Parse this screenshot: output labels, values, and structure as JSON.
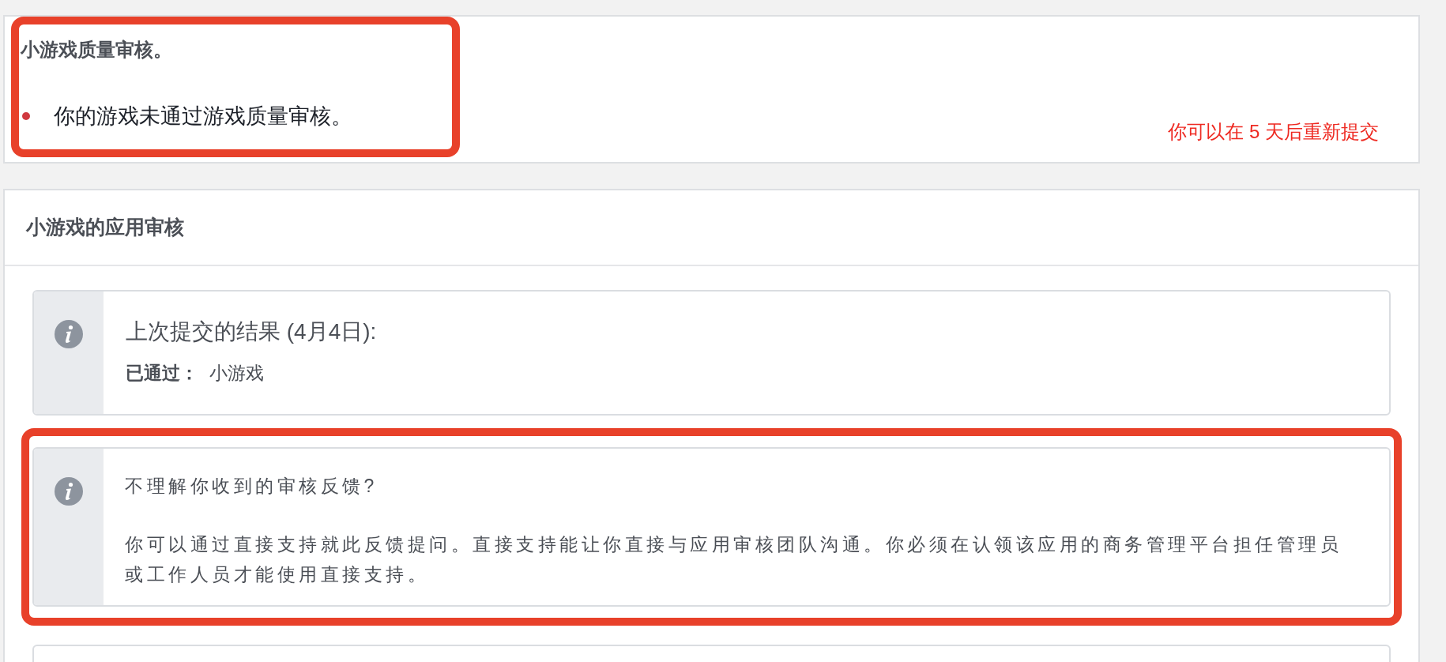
{
  "quality_review": {
    "title": "小游戏质量审核。",
    "highlighted": true,
    "items": [
      "你的游戏未通过游戏质量审核。"
    ],
    "resubmit_note": "你可以在 5 天后重新提交"
  },
  "app_review": {
    "title": "小游戏的应用审核",
    "notices": [
      {
        "title": "上次提交的结果 (4月4日):",
        "status_label": "已通过：",
        "status_value": "小游戏",
        "highlighted": false
      },
      {
        "question": "不理解你收到的审核反馈?",
        "body": "你可以通过直接支持就此反馈提问。直接支持能让你直接与应用审核团队沟通。你必须在认领该应用的商务管理平台担任管理员或工作人员才能使用直接支持。",
        "highlighted": true
      }
    ]
  }
}
